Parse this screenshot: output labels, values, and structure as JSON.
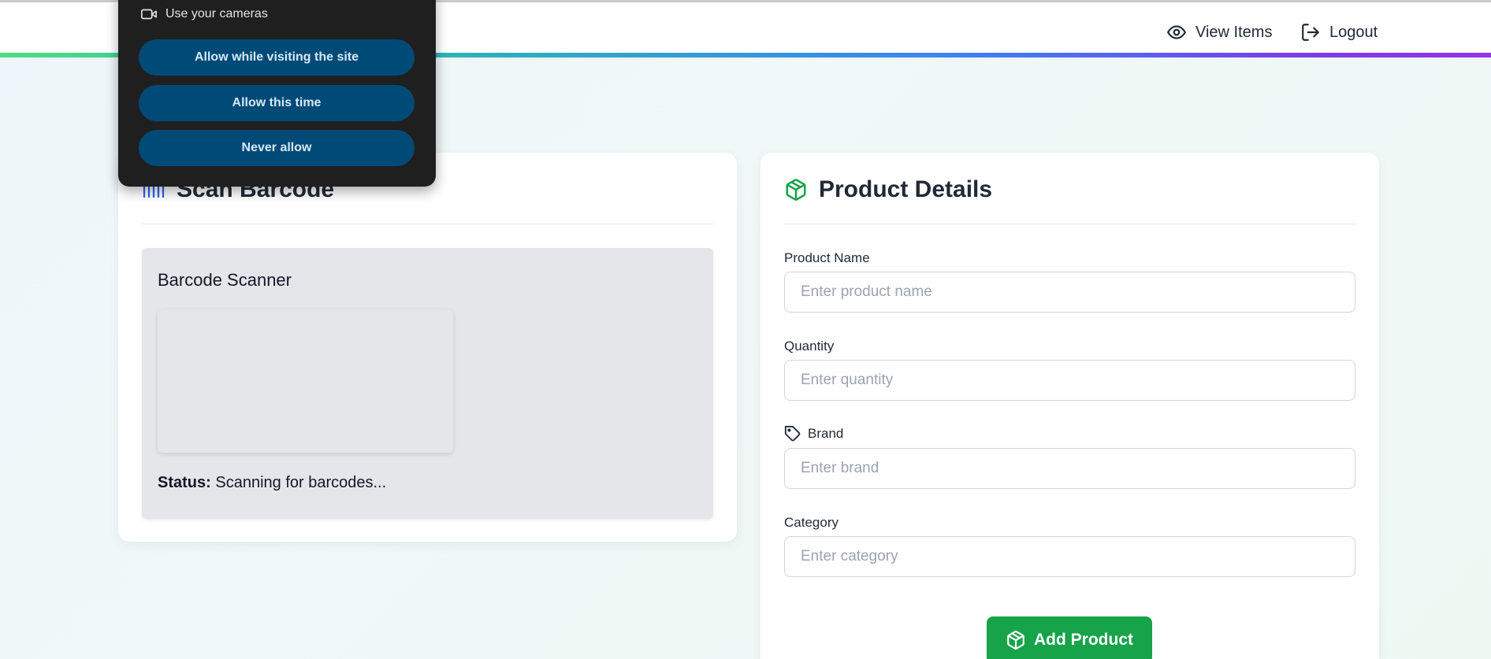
{
  "header": {
    "nav": {
      "view_items": "View Items",
      "logout": "Logout"
    }
  },
  "permission_popup": {
    "prompt": "Use your cameras",
    "buttons": {
      "allow_while_visiting": "Allow while visiting the site",
      "allow_this_time": "Allow this time",
      "never_allow": "Never allow"
    }
  },
  "scan_card": {
    "title": "Scan Barcode",
    "scanner": {
      "title": "Barcode Scanner",
      "status_label": "Status:",
      "status_value": "Scanning for barcodes..."
    }
  },
  "product_card": {
    "title": "Product Details",
    "fields": {
      "name": {
        "label": "Product Name",
        "placeholder": "Enter product name",
        "value": ""
      },
      "quantity": {
        "label": "Quantity",
        "placeholder": "Enter quantity",
        "value": ""
      },
      "brand": {
        "label": "Brand",
        "placeholder": "Enter brand",
        "value": ""
      },
      "category": {
        "label": "Category",
        "placeholder": "Enter category",
        "value": ""
      }
    },
    "submit_label": "Add Product"
  },
  "colors": {
    "accent_green": "#16a34a",
    "accent_blue": "#2563eb",
    "popup_background": "#1f1f1f",
    "popup_button": "#004a77"
  },
  "icons": {
    "view_items": "eye-icon",
    "logout": "logout-icon",
    "camera": "camera-icon",
    "scan": "barcode-icon",
    "product": "package-icon",
    "brand": "tag-icon",
    "submit": "package-icon"
  }
}
